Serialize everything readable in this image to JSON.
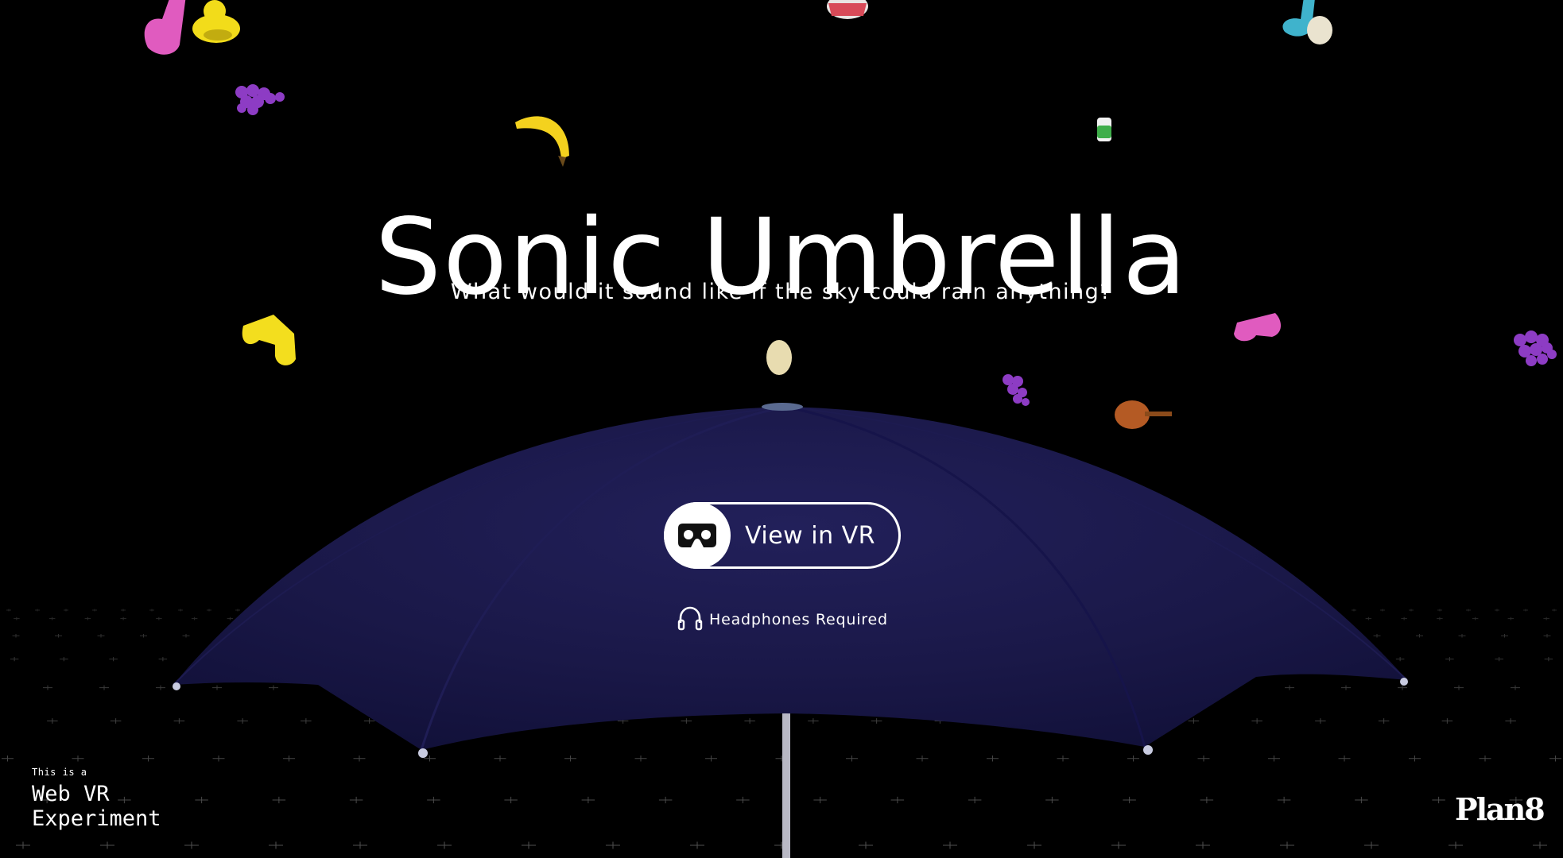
{
  "hero": {
    "title": "Sonic Umbrella",
    "subtitle": "What would it sound like if the sky could rain anything?"
  },
  "actions": {
    "vr_button_label": "View in VR",
    "vr_icon": "vr-headset-icon"
  },
  "notice": {
    "headphones_label": "Headphones Required",
    "headphones_icon": "headphones-icon"
  },
  "badge": {
    "small": "This is a",
    "line1": "Web VR",
    "line2": "Experiment"
  },
  "brand": {
    "logo_text": "Plan8"
  },
  "colors": {
    "background": "#000000",
    "umbrella_canopy": "#1a1848",
    "text": "#ffffff"
  },
  "falling_objects": [
    "music-note",
    "rubber-duck",
    "drum",
    "grapes",
    "banana",
    "battery",
    "egg",
    "violin"
  ]
}
